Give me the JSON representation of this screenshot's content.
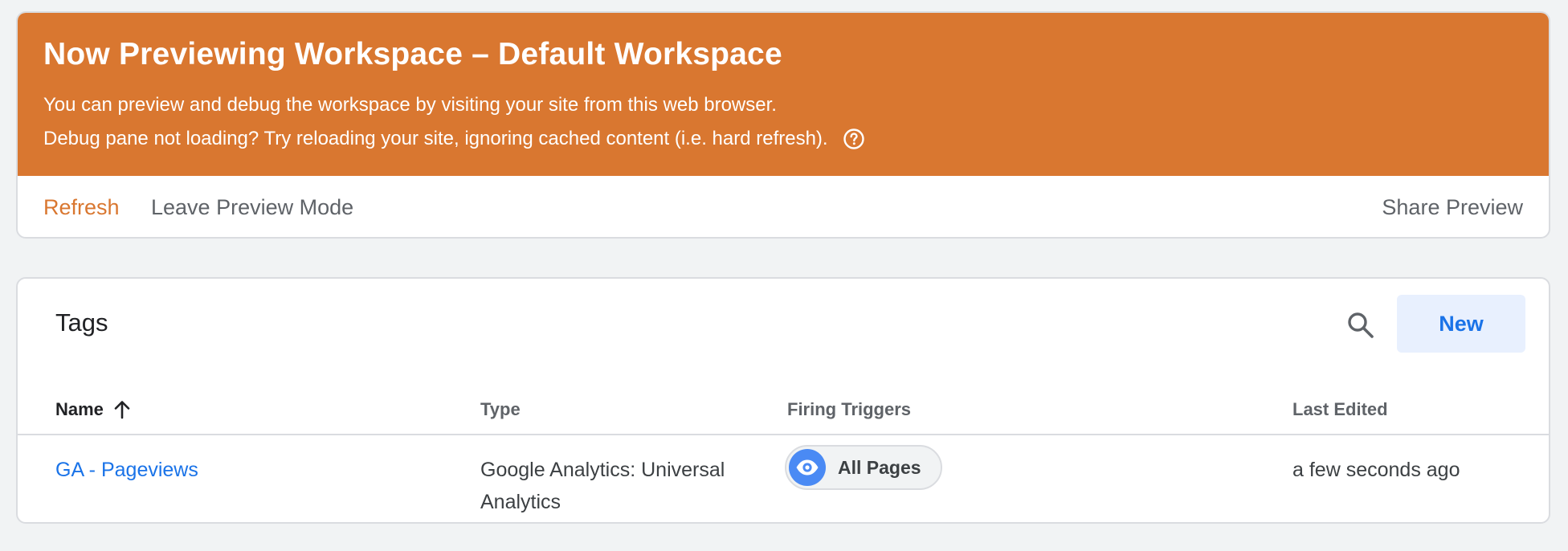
{
  "preview": {
    "title": "Now Previewing Workspace – Default Workspace",
    "description_line1": "You can preview and debug the workspace by visiting your site from this web browser.",
    "description_line2": "Debug pane not loading? Try reloading your site, ignoring cached content (i.e. hard refresh).",
    "help_icon": "help-circle-icon",
    "actions": {
      "refresh": "Refresh",
      "leave": "Leave Preview Mode",
      "share": "Share Preview"
    },
    "colors": {
      "banner": "#d97730",
      "accent": "#d97730"
    }
  },
  "tags": {
    "title": "Tags",
    "search_icon": "search-icon",
    "new_label": "New",
    "columns": {
      "name": "Name",
      "type": "Type",
      "triggers": "Firing Triggers",
      "last_edited": "Last Edited"
    },
    "sort": {
      "column": "name",
      "direction": "ascending",
      "icon": "arrow-up-icon"
    },
    "rows": [
      {
        "name": "GA - Pageviews",
        "type": "Google Analytics: Universal Analytics",
        "trigger": {
          "label": "All Pages",
          "icon": "eye-icon"
        },
        "last_edited": "a few seconds ago"
      }
    ],
    "colors": {
      "link": "#1a73e8",
      "new_button_bg": "#e8f0fe",
      "trigger_icon_bg": "#4a8af4"
    }
  }
}
